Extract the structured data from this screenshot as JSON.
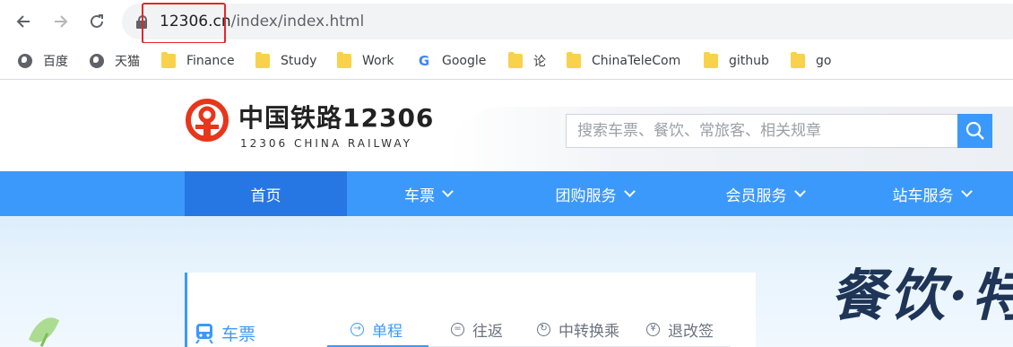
{
  "browser": {
    "back_icon": "arrow-left-icon",
    "forward_icon": "arrow-right-icon",
    "reload_icon": "reload-icon",
    "url_host": "12306.cn",
    "url_path": "/index/index.html"
  },
  "bookmarks": [
    {
      "label": "百度",
      "icon": "globe-icon"
    },
    {
      "label": "天猫",
      "icon": "globe-icon"
    },
    {
      "label": "Finance",
      "icon": "folder-icon"
    },
    {
      "label": "Study",
      "icon": "folder-icon"
    },
    {
      "label": "Work",
      "icon": "folder-icon"
    },
    {
      "label": "Google",
      "icon": "google-icon"
    },
    {
      "label": "论",
      "icon": "folder-icon"
    },
    {
      "label": "ChinaTeleCom",
      "icon": "folder-icon"
    },
    {
      "label": "github",
      "icon": "folder-icon"
    },
    {
      "label": "go",
      "icon": "folder-icon"
    }
  ],
  "site": {
    "brand_cn": "中国铁路12306",
    "brand_en": "12306 CHINA RAILWAY",
    "search_placeholder": "搜索车票、餐饮、常旅客、相关规章",
    "accent": "#3b99fc",
    "active_nav_color": "#2676e3",
    "logo_color": "#e8361b"
  },
  "nav": [
    {
      "label": "首页",
      "active": true
    },
    {
      "label": "车票",
      "dropdown": true
    },
    {
      "label": "团购服务",
      "dropdown": true
    },
    {
      "label": "会员服务",
      "dropdown": true
    },
    {
      "label": "站车服务",
      "dropdown": true
    }
  ],
  "hero": {
    "promo_text": "餐饮·特",
    "panel_title": "车票",
    "tabs": [
      {
        "label": "单程",
        "icon": "arrow-circle-icon",
        "active": true
      },
      {
        "label": "往返",
        "icon": "return-circle-icon"
      },
      {
        "label": "中转换乘",
        "icon": "transfer-circle-icon"
      },
      {
        "label": "退改签",
        "icon": "refund-circle-icon"
      }
    ]
  }
}
